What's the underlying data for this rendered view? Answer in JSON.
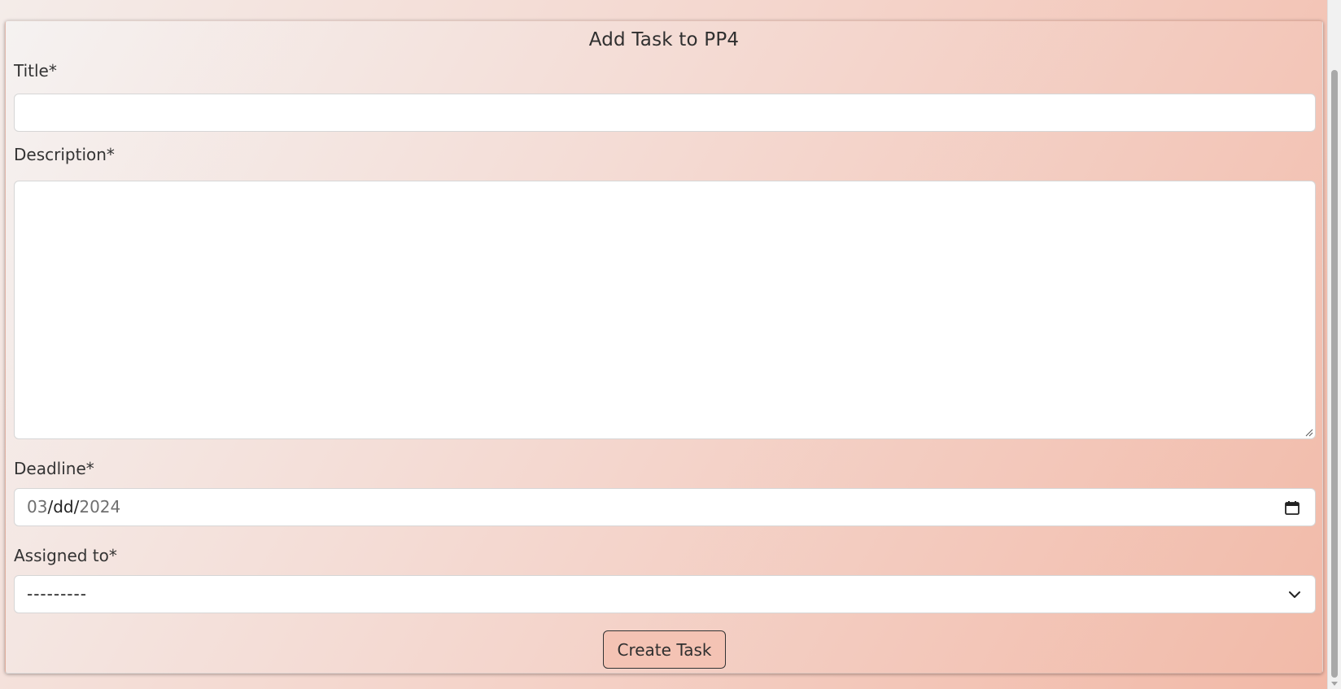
{
  "form": {
    "title": "Add Task to PP4",
    "fields": {
      "title": {
        "label": "Title*",
        "value": "",
        "placeholder": ""
      },
      "description": {
        "label": "Description*",
        "value": "",
        "placeholder": ""
      },
      "deadline": {
        "label": "Deadline*",
        "month": "03",
        "day": "dd",
        "year": "2024",
        "sep": "/"
      },
      "assigned_to": {
        "label": "Assigned to*",
        "selected": "---------"
      }
    },
    "submit_label": "Create Task"
  },
  "icons": {
    "calendar": "calendar-icon",
    "chevron": "chevron-down-icon",
    "resize": "resize-grip-icon"
  },
  "colors": {
    "button_bg": "#f4c3b4",
    "card_gradient_start": "#f5f2f1",
    "card_gradient_end": "#f2baa8"
  }
}
